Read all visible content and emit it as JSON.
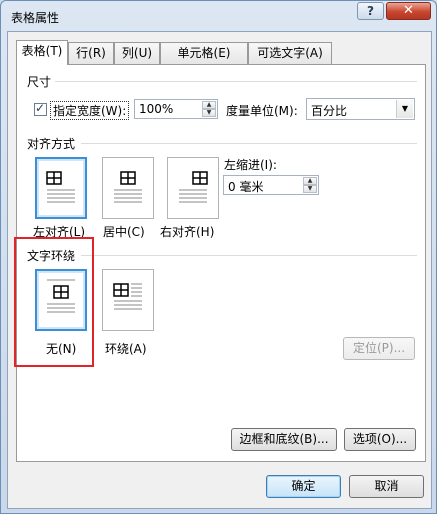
{
  "window": {
    "title": "表格属性",
    "help_label": "?",
    "close_label": "✕"
  },
  "tabs": [
    {
      "label": "表格(T)",
      "active": true
    },
    {
      "label": "行(R)",
      "active": false
    },
    {
      "label": "列(U)",
      "active": false
    },
    {
      "label": "单元格(E)",
      "active": false
    },
    {
      "label": "可选文字(A)",
      "active": false
    }
  ],
  "size_section": {
    "heading": "尺寸",
    "preferred_width_label": "指定宽度(W):",
    "preferred_width_checked": true,
    "width_value": "100%",
    "measure_label": "度量单位(M):",
    "measure_value": "百分比"
  },
  "alignment_section": {
    "heading": "对齐方式",
    "options": [
      {
        "label": "左对齐(L)",
        "selected": true
      },
      {
        "label": "居中(C)",
        "selected": false
      },
      {
        "label": "右对齐(H)",
        "selected": false
      }
    ],
    "indent_label": "左缩进(I):",
    "indent_value": "0 毫米"
  },
  "wrapping_section": {
    "heading": "文字环绕",
    "options": [
      {
        "label": "无(N)",
        "selected": true
      },
      {
        "label": "环绕(A)",
        "selected": false
      }
    ],
    "positioning_button": "定位(P)..."
  },
  "buttons": {
    "borders_shading": "边框和底纹(B)...",
    "options": "选项(O)...",
    "ok": "确定",
    "cancel": "取消"
  },
  "colors": {
    "selection_border": "#3c8fd6",
    "highlight_box": "#e0242a"
  }
}
